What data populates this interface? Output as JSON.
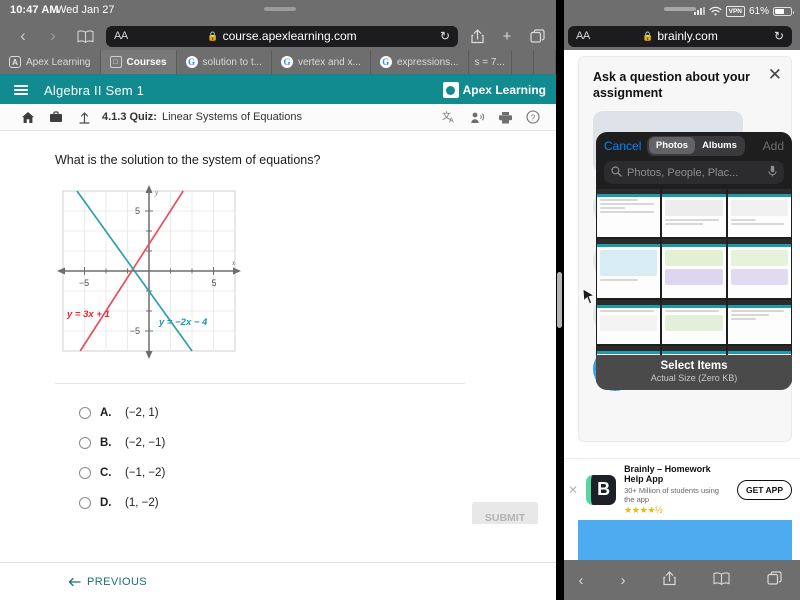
{
  "status": {
    "time": "10:47 AM",
    "date": "Wed Jan 27"
  },
  "left_browser": {
    "url": "course.apexlearning.com",
    "aa_label": "AA",
    "back_icon": "chevron-left-icon",
    "forward_icon": "chevron-right-icon",
    "bookmarks_icon": "book-icon",
    "reload_icon": "reload-icon",
    "share_icon": "share-icon",
    "newtab_icon": "plus-icon",
    "tabs_icon": "tabs-icon",
    "tabs": [
      {
        "label": "Apex Learning",
        "favicon": "apex-favicon",
        "active": false
      },
      {
        "label": "Courses",
        "favicon": "x-favicon",
        "active": true
      },
      {
        "label": "solution to t...",
        "favicon": "google-favicon",
        "active": false
      },
      {
        "label": "vertex and x...",
        "favicon": "google-favicon",
        "active": false
      },
      {
        "label": "expressions...",
        "favicon": "google-favicon",
        "active": false
      },
      {
        "label": "s = 7...",
        "favicon": "none",
        "active": false
      }
    ]
  },
  "apex": {
    "course_title": "Algebra II Sem 1",
    "brand": "Apex Learning",
    "menu_icon": "hamburger-icon",
    "breadcrumb": {
      "home_icon": "home-icon",
      "briefcase_icon": "briefcase-icon",
      "up_icon": "arrow-up-icon",
      "number": "4.1.3",
      "kind": "Quiz:",
      "title": "Linear Systems of Equations",
      "tools": [
        {
          "icon": "translate-icon"
        },
        {
          "icon": "read-aloud-icon"
        },
        {
          "icon": "print-icon"
        },
        {
          "icon": "help-icon"
        }
      ]
    },
    "question": "What is the solution to the system of equations?",
    "answers": [
      {
        "letter": "A.",
        "text": "(−2, 1)"
      },
      {
        "letter": "B.",
        "text": "(−2, −1)"
      },
      {
        "letter": "C.",
        "text": "(−1, −2)"
      },
      {
        "letter": "D.",
        "text": "(1, −2)"
      }
    ],
    "submit_label": "SUBMIT",
    "previous_label": "PREVIOUS",
    "previous_icon": "arrow-left-icon"
  },
  "chart_data": {
    "type": "line",
    "title": "",
    "xlabel": "x",
    "ylabel": "y",
    "xlim": [
      -8,
      8
    ],
    "ylim": [
      -8,
      8
    ],
    "xticks": [
      -5,
      5
    ],
    "yticks": [
      5,
      -5
    ],
    "grid": true,
    "series": [
      {
        "name": "y = 3x + 1",
        "equation": "y = 3x + 1",
        "slope": 3,
        "intercept": 1,
        "color": "#e04a5f"
      },
      {
        "name": "y = –2x – 4",
        "equation": "y = –2x – 4",
        "slope": -2,
        "intercept": -4,
        "color": "#2596a8"
      }
    ],
    "annotations": [
      {
        "text": "y = 3x + 1",
        "color": "#e0222f"
      },
      {
        "text": "y = –2x – 4",
        "color": "#1d92a8"
      }
    ],
    "intersection": [
      -1,
      -2
    ]
  },
  "right_browser": {
    "url": "brainly.com",
    "aa_label": "AA",
    "signal": "signal-icon",
    "wifi": "wifi-icon",
    "vpn_badge": "VPN",
    "battery_percent": "61%",
    "reload_icon": "reload-icon",
    "bottom_icons": [
      {
        "icon": "chevron-left-icon"
      },
      {
        "icon": "chevron-right-icon"
      },
      {
        "icon": "share-icon"
      },
      {
        "icon": "book-icon"
      },
      {
        "icon": "tabs-icon"
      }
    ]
  },
  "brainly": {
    "modal_title": "Ask a question about your assignment",
    "close_icon": "close-icon",
    "promo": {
      "name": "Brainly – Homework Help App",
      "subtitle": "30+ Million of students using the app",
      "stars": "★★★★½",
      "cta": "GET APP",
      "dismiss_icon": "close-icon",
      "logo_letter": "B"
    }
  },
  "photo_picker": {
    "cancel_label": "Cancel",
    "segments": [
      {
        "label": "Photos",
        "selected": true
      },
      {
        "label": "Albums",
        "selected": false
      }
    ],
    "add_label": "Add",
    "search_placeholder": "Photos, People, Plac...",
    "search_icon": "search-icon",
    "mic_icon": "microphone-icon",
    "footer_title": "Select Items",
    "footer_subtitle": "Actual Size (Zero KB)",
    "thumbnail_count": 12
  }
}
